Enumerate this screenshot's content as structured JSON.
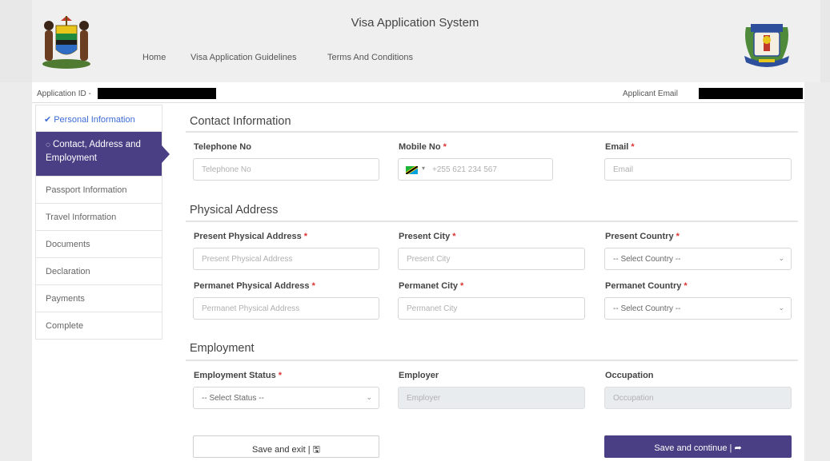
{
  "header": {
    "app_title": "Visa Application System",
    "nav": [
      {
        "label": "Home"
      },
      {
        "label": "Visa Application Guidelines"
      },
      {
        "label": "Terms And Conditions"
      }
    ]
  },
  "topbar": {
    "application_id_label": "Application ID -",
    "applicant_email_label": "Applicant Email"
  },
  "sidebar": {
    "items": [
      {
        "label": "Personal Information",
        "state": "done"
      },
      {
        "label": "Contact, Address and Employment",
        "state": "active"
      },
      {
        "label": "Passport Information"
      },
      {
        "label": "Travel Information"
      },
      {
        "label": "Documents"
      },
      {
        "label": "Declaration"
      },
      {
        "label": "Payments"
      },
      {
        "label": "Complete"
      }
    ]
  },
  "contact": {
    "title": "Contact Information",
    "telephone": {
      "label": "Telephone No",
      "placeholder": "Telephone No"
    },
    "mobile": {
      "label": "Mobile No",
      "placeholder": "+255 621 234 567"
    },
    "email": {
      "label": "Email",
      "placeholder": "Email"
    }
  },
  "address": {
    "title": "Physical Address",
    "present_address": {
      "label": "Present Physical Address",
      "placeholder": "Present Physical Address"
    },
    "present_city": {
      "label": "Present City",
      "placeholder": "Present City"
    },
    "present_country": {
      "label": "Present Country",
      "value": "-- Select Country --"
    },
    "permanent_address": {
      "label": "Permanet Physical Address",
      "placeholder": "Permanet Physical Address"
    },
    "permanent_city": {
      "label": "Permanet City",
      "placeholder": "Permanet City"
    },
    "permanent_country": {
      "label": "Permanet Country",
      "value": "-- Select Country --"
    }
  },
  "employment": {
    "title": "Employment",
    "status": {
      "label": "Employment Status",
      "value": "-- Select Status --"
    },
    "employer": {
      "label": "Employer",
      "placeholder": "Employer"
    },
    "occupation": {
      "label": "Occupation",
      "placeholder": "Occupation"
    }
  },
  "buttons": {
    "save_exit": "Save and exit | 🖫",
    "save_continue": "Save and continue | ➦"
  },
  "required_mark": "*",
  "colors": {
    "accent": "#4a3f85",
    "link": "#3d6bd6",
    "required": "#dd3333"
  }
}
